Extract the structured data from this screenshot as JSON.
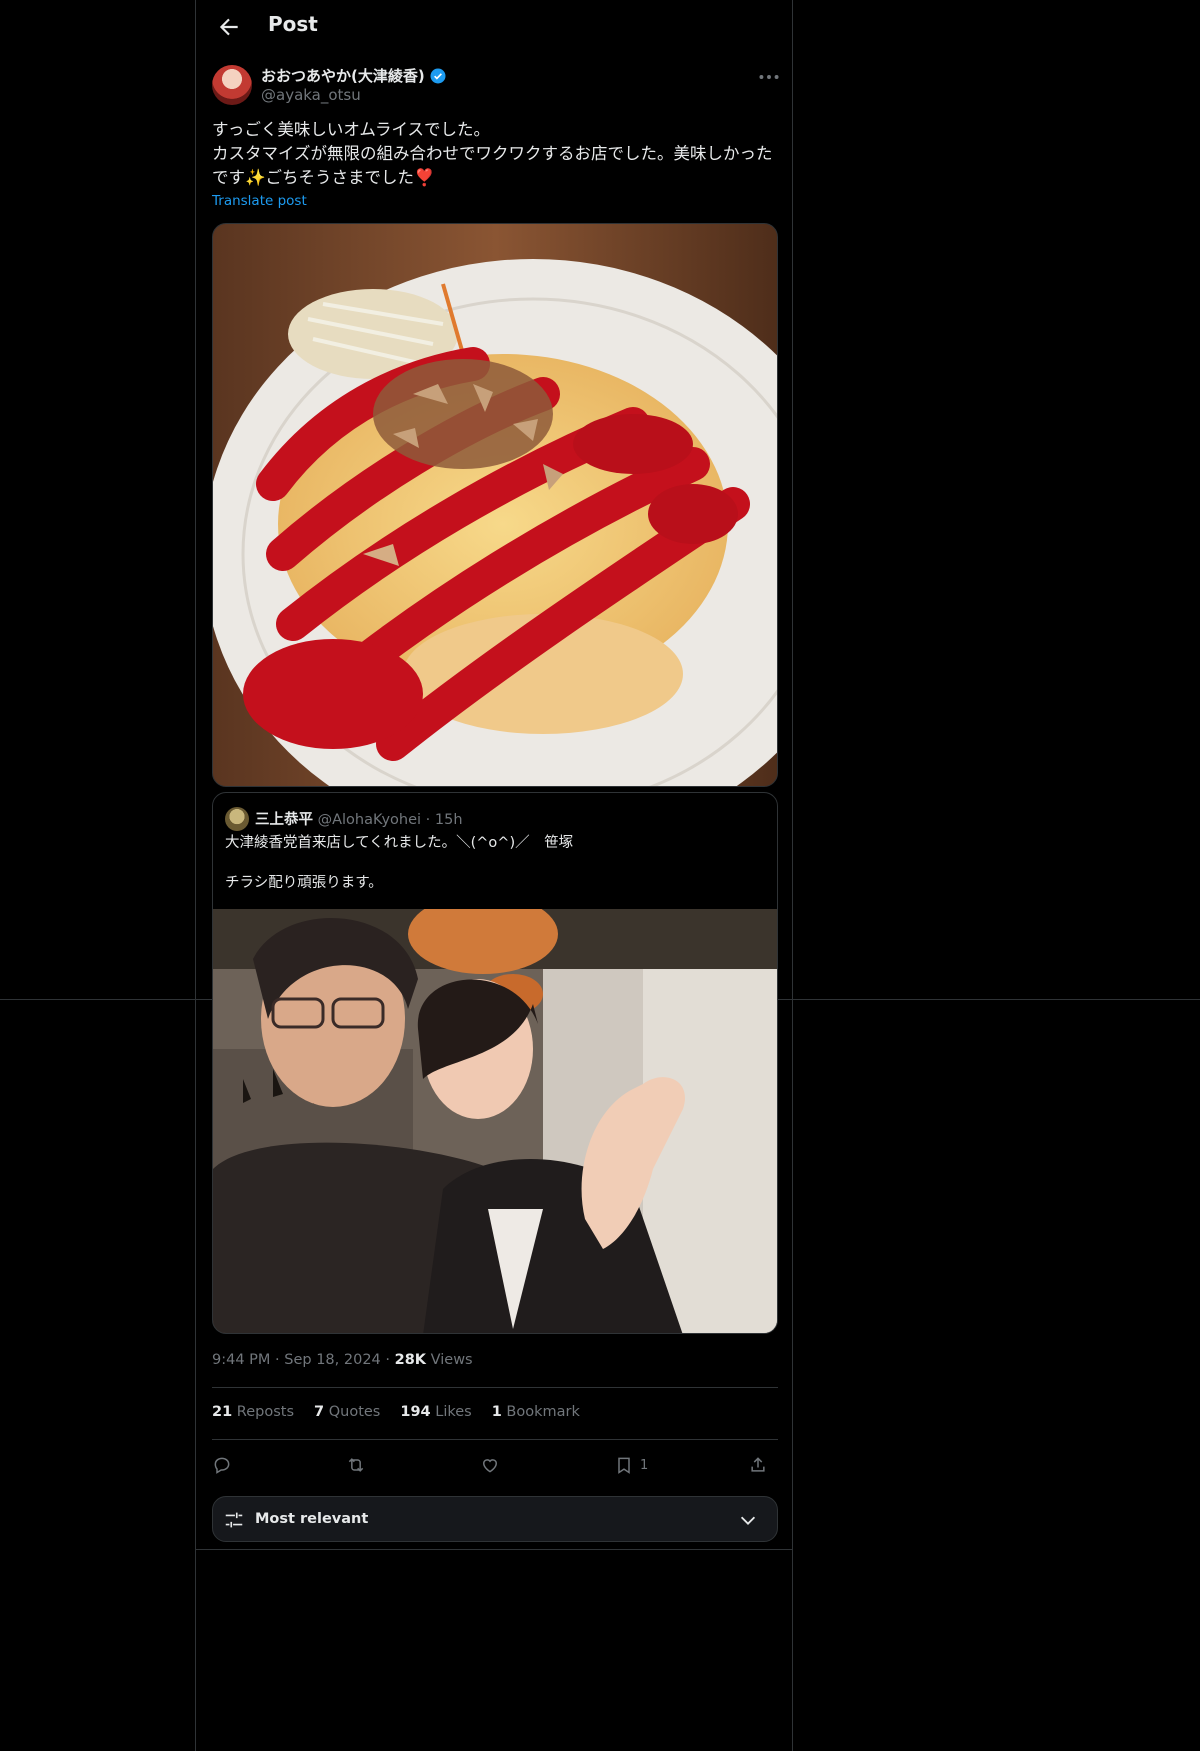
{
  "header": {
    "title": "Post"
  },
  "author": {
    "display_name": "おおつあやか(大津綾香)",
    "handle": "@ayaka_otsu"
  },
  "post": {
    "text": "すっごく美味しいオムライスでした。\nカスタマイズが無限の組み合わせでワクワクするお店でした。美味しかったです✨ごちそうさまでした❣️",
    "translate_label": "Translate post",
    "photo_alt": "omurice with ketchup"
  },
  "quote": {
    "display_name": "三上恭平",
    "handle": "@AlohaKyohei",
    "separator": "·",
    "time": "15h",
    "text": "大津綾香党首来店してくれました。＼(^o^)／　笹塚\n\nチラシ配り頑張ります。"
  },
  "meta": {
    "time": "9:44 PM",
    "sep": "·",
    "date": "Sep 18, 2024",
    "views_count": "28K",
    "views_label": "Views"
  },
  "stats": {
    "reposts_count": "21",
    "reposts_label": "Reposts",
    "quotes_count": "7",
    "quotes_label": "Quotes",
    "likes_count": "194",
    "likes_label": "Likes",
    "bookmarks_count": "1",
    "bookmarks_label": "Bookmark"
  },
  "actions": {
    "bookmark_count": "1"
  },
  "sort": {
    "label": "Most relevant"
  },
  "icons": [
    "back-arrow-icon",
    "verified-badge-icon",
    "more-icon",
    "reply-icon",
    "repost-icon",
    "like-icon",
    "bookmark-icon",
    "share-icon",
    "sliders-icon",
    "chevron-down-icon"
  ],
  "colors": {
    "background": "#000000",
    "text": "#e7e9ea",
    "muted": "#71767b",
    "link": "#1d9bf0",
    "verified": "#1d9bf0",
    "border": "#2f3336"
  }
}
